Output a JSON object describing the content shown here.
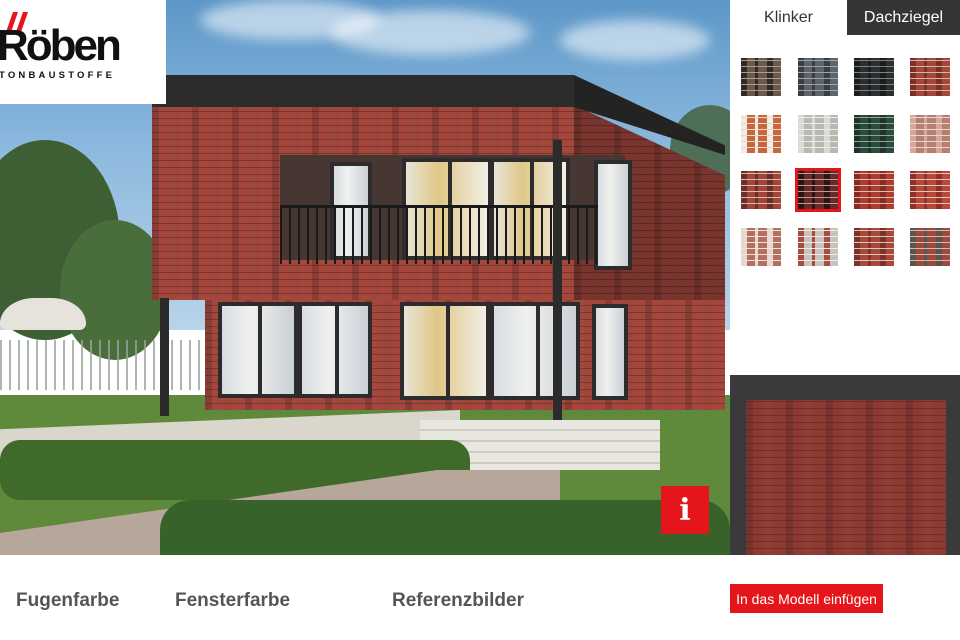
{
  "logo": {
    "wordmark": "Röben",
    "tagline": "TONBAUSTOFFE"
  },
  "tabs": [
    {
      "label": "Klinker",
      "active": true
    },
    {
      "label": "Dachziegel",
      "active": false
    }
  ],
  "swatches": [
    {
      "base": "#6b5a4c",
      "accent": "#2e2a25",
      "mortar": "#a79e92",
      "selected": false
    },
    {
      "base": "#5e646c",
      "accent": "#3a3e44",
      "mortar": "#9ea4aa",
      "selected": false
    },
    {
      "base": "#2c2f30",
      "accent": "#1a1c1d",
      "mortar": "#7c8184",
      "selected": false
    },
    {
      "base": "#a4463a",
      "accent": "#7d2e25",
      "mortar": "#c9b9a8",
      "selected": false
    },
    {
      "base": "#c8673c",
      "accent": "#f1ede6",
      "mortar": "#e5ddd2",
      "selected": false
    },
    {
      "base": "#b8b9b2",
      "accent": "#d9dad4",
      "mortar": "#ecebe6",
      "selected": false
    },
    {
      "base": "#2b4b3c",
      "accent": "#1d3429",
      "mortar": "#8fa397",
      "selected": false
    },
    {
      "base": "#b77e72",
      "accent": "#d6a79a",
      "mortar": "#e8d8d0",
      "selected": false
    },
    {
      "base": "#a4453a",
      "accent": "#6b2d26",
      "mortar": "#cdbfb1",
      "selected": false
    },
    {
      "base": "#6b2a27",
      "accent": "#2a1514",
      "mortar": "#b69e98",
      "selected": true
    },
    {
      "base": "#b03c31",
      "accent": "#8a2b23",
      "mortar": "#d6c2b2",
      "selected": false
    },
    {
      "base": "#b9473a",
      "accent": "#8f3026",
      "mortar": "#dcc9ba",
      "selected": false
    },
    {
      "base": "#b46f60",
      "accent": "#e6d7cf",
      "mortar": "#ede4dd",
      "selected": false
    },
    {
      "base": "#c9c3bd",
      "accent": "#a84b41",
      "mortar": "#efebe7",
      "selected": false
    },
    {
      "base": "#a8493b",
      "accent": "#7c3228",
      "mortar": "#d9c8b9",
      "selected": false
    },
    {
      "base": "#9c4a3d",
      "accent": "#5e524c",
      "mortar": "#c9bcb2",
      "selected": false
    }
  ],
  "colors": {
    "accent_red": "#e4161b",
    "dark_panel": "#353535",
    "preview_frame": "#3a3a3a",
    "nav_arrow": "#e4161b",
    "bottom_text": "#555555"
  },
  "info_button": {
    "label": "i"
  },
  "bottom": {
    "fugenfarbe": "Fugenfarbe",
    "fensterfarbe": "Fensterfarbe",
    "referenzbilder": "Referenzbilder",
    "insert_label": "In das Modell einfügen"
  },
  "icons": {
    "prev": "chevron-left-icon",
    "next": "chevron-right-icon",
    "info": "info-icon"
  }
}
